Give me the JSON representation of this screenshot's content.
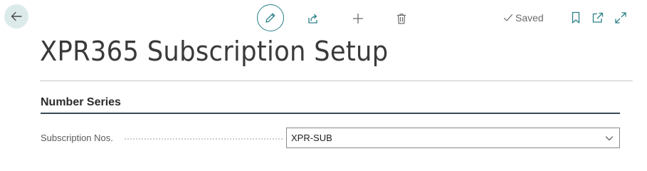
{
  "page": {
    "title": "XPR365 Subscription Setup"
  },
  "toolbar": {
    "back_icon": "arrow-left-icon",
    "edit_icon": "pencil-icon",
    "share_icon": "share-icon",
    "new_icon": "plus-icon",
    "delete_icon": "trash-icon",
    "status_label": "Saved",
    "status_icon": "checkmark-icon",
    "bookmark_icon": "bookmark-icon",
    "popout_icon": "open-in-new-window-icon",
    "expand_icon": "expand-icon",
    "accent_color": "#2a7f86"
  },
  "section": {
    "title": "Number Series",
    "fields": [
      {
        "label": "Subscription Nos.",
        "value": "XPR-SUB",
        "type": "dropdown"
      }
    ]
  }
}
